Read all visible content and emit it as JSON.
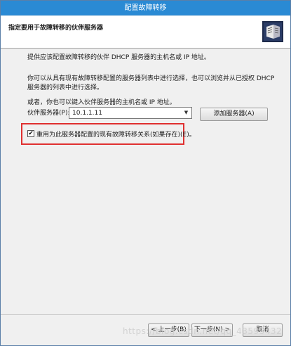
{
  "window": {
    "title": "配置故障转移"
  },
  "header": {
    "title": "指定要用于故障转移的伙伴服务器"
  },
  "content": {
    "intro": "提供应该配置故障转移的伙伴 DHCP 服务器的主机名或 IP 地址。",
    "choose_line1": "你可以从具有现有故障转移配置的服务器列表中进行选择，也可以浏览并从已授权 DHCP",
    "choose_line2": "服务器的列表中进行选择。",
    "or_enter": "或者，你也可以键入伙伴服务器的主机名或 IP 地址。",
    "partner_label": "伙伴服务器(P):",
    "partner_value": "10.1.1.11",
    "add_server_button": "添加服务器(A)",
    "reuse_checkbox_label": "重用为此服务器配置的现有故障转移关系(如果存在)(E)。",
    "reuse_checked": true,
    "checkmark": "✔"
  },
  "footer": {
    "back_label": "< 上一步(B)",
    "next_label": "下一步(N) >",
    "cancel_label": "取消"
  },
  "watermark": "https://blog.csdn.net/qq_43595432",
  "colors": {
    "titlebar": "#2a8ad4",
    "highlight_box": "#e03030"
  }
}
